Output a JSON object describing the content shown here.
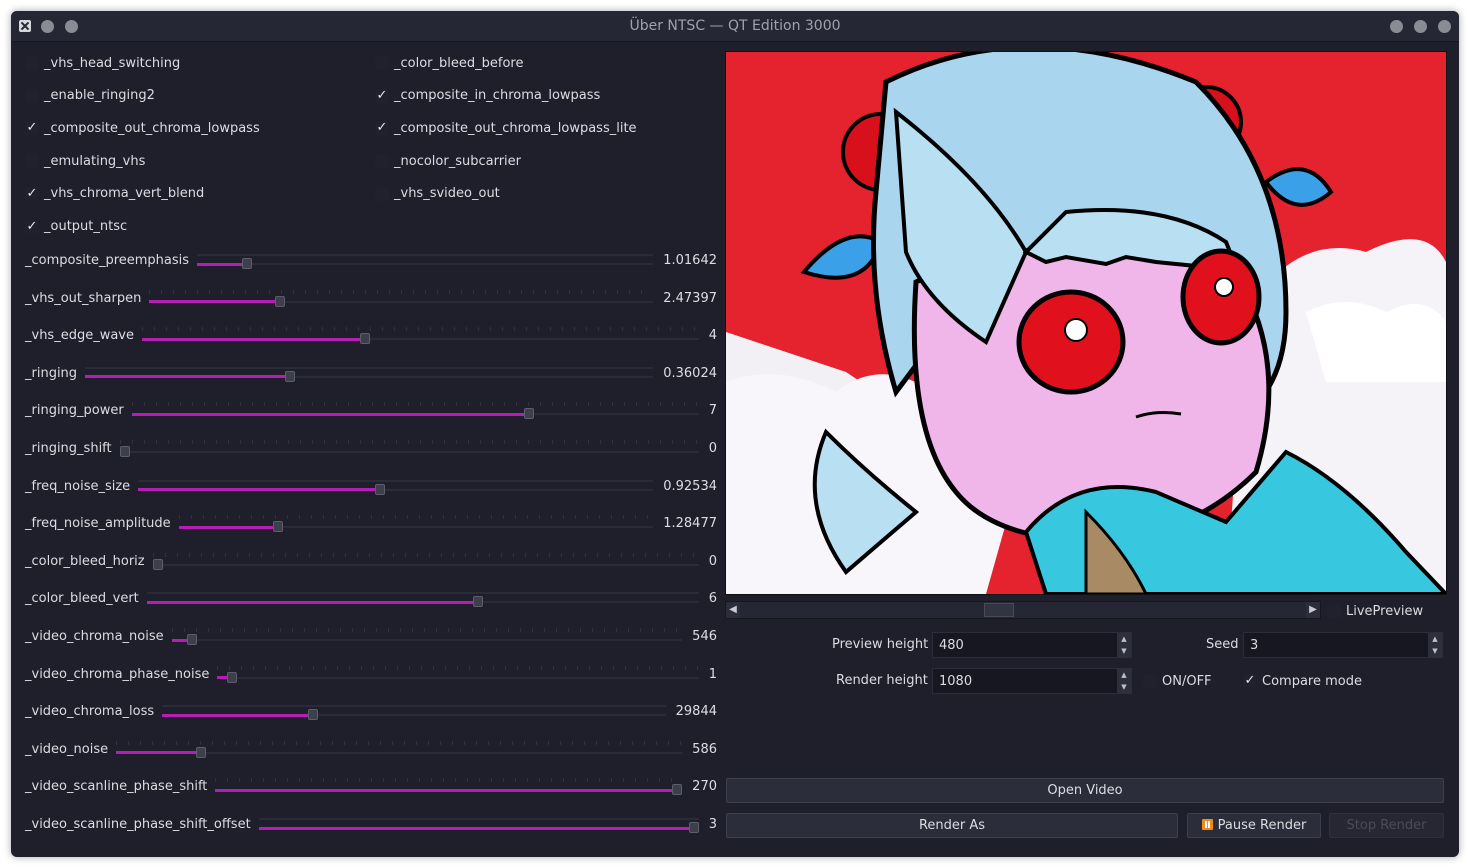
{
  "window": {
    "title": "Über NTSC — QT Edition 3000"
  },
  "checkboxes": [
    {
      "label": "_vhs_head_switching",
      "checked": false
    },
    {
      "label": "_color_bleed_before",
      "checked": false
    },
    {
      "label": "_enable_ringing2",
      "checked": false
    },
    {
      "label": "_composite_in_chroma_lowpass",
      "checked": true
    },
    {
      "label": "_composite_out_chroma_lowpass",
      "checked": true
    },
    {
      "label": "_composite_out_chroma_lowpass_lite",
      "checked": true
    },
    {
      "label": "_emulating_vhs",
      "checked": false
    },
    {
      "label": "_nocolor_subcarrier",
      "checked": false
    },
    {
      "label": "_vhs_chroma_vert_blend",
      "checked": true
    },
    {
      "label": "_vhs_svideo_out",
      "checked": false
    },
    {
      "label": "_output_ntsc",
      "checked": true
    }
  ],
  "sliders": [
    {
      "label": "_composite_preemphasis",
      "value": "1.01642",
      "fraction": 0.11
    },
    {
      "label": "_vhs_out_sharpen",
      "value": "2.47397",
      "fraction": 0.26
    },
    {
      "label": "_vhs_edge_wave",
      "value": "4",
      "fraction": 0.4
    },
    {
      "label": "_ringing",
      "value": "0.36024",
      "fraction": 0.36
    },
    {
      "label": "_ringing_power",
      "value": "7",
      "fraction": 0.7
    },
    {
      "label": "_ringing_shift",
      "value": "0",
      "fraction": 0.0
    },
    {
      "label": "_freq_noise_size",
      "value": "0.92534",
      "fraction": 0.47
    },
    {
      "label": "_freq_noise_amplitude",
      "value": "1.28477",
      "fraction": 0.21
    },
    {
      "label": "_color_bleed_horiz",
      "value": "0",
      "fraction": 0.0
    },
    {
      "label": "_color_bleed_vert",
      "value": "6",
      "fraction": 0.6
    },
    {
      "label": "_video_chroma_noise",
      "value": "546",
      "fraction": 0.04
    },
    {
      "label": "_video_chroma_phase_noise",
      "value": "1",
      "fraction": 0.03
    },
    {
      "label": "_video_chroma_loss",
      "value": "29844",
      "fraction": 0.3
    },
    {
      "label": "_video_noise",
      "value": "586",
      "fraction": 0.15
    },
    {
      "label": "_video_scanline_phase_shift",
      "value": "270",
      "fraction": 1.0
    },
    {
      "label": "_video_scanline_phase_shift_offset",
      "value": "3",
      "fraction": 1.0
    }
  ],
  "preview_panel": {
    "live_preview_label": "LivePreview",
    "live_preview_checked": false,
    "preview_height_label": "Preview height",
    "preview_height_value": "480",
    "seed_label": "Seed",
    "seed_value": "3",
    "render_height_label": "Render height",
    "render_height_value": "1080",
    "onoff_label": "ON/OFF",
    "onoff_checked": false,
    "compare_mode_label": "Compare mode",
    "compare_mode_checked": true
  },
  "buttons": {
    "open_video": "Open Video",
    "render_as": "Render As",
    "pause_render": "Pause Render",
    "stop_render": "Stop Render"
  },
  "colors": {
    "accent": "#b41eb4",
    "background": "#1e1f2b",
    "pause_icon": "#f08a1a"
  },
  "icons": {
    "app": "app-x-icon",
    "check": "✓",
    "pause": "pause-icon"
  }
}
